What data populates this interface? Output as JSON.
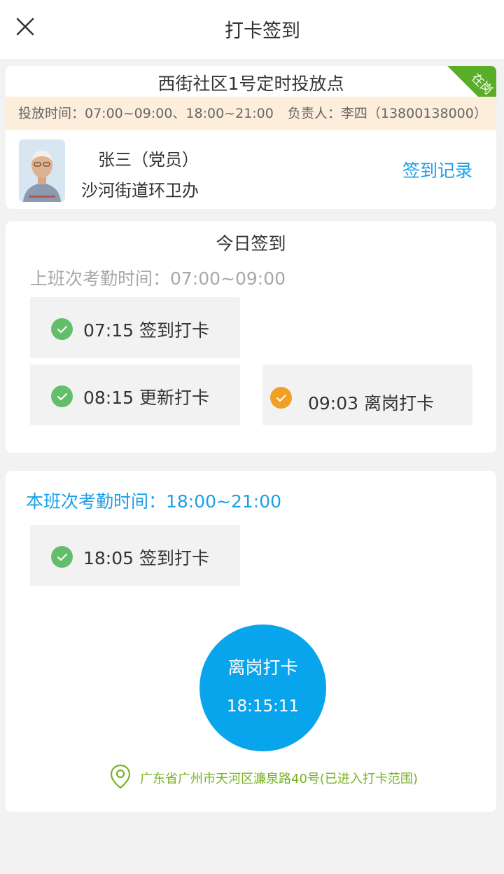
{
  "header": {
    "title": "打卡签到",
    "close_icon": "close-icon"
  },
  "station": {
    "name": "西街社区1号定时投放点",
    "status_badge": "在岗",
    "status_color": "#5aad26",
    "schedule": "投放时间：07:00~09:00、18:00~21:00",
    "manager": "负责人：李四（13800138000）"
  },
  "user": {
    "name": "张三（党员）",
    "org": "沙河街道环卫办",
    "records_link": "签到记录",
    "avatar": "avatar-photo"
  },
  "today": {
    "title": "今日签到",
    "shift1": {
      "label": "上班次考勤时间：07:00~09:00",
      "punches": [
        {
          "text": "07:15 签到打卡",
          "status": "ok",
          "icon": "check-icon",
          "color": "#63be6b"
        },
        {
          "text": "08:15 更新打卡",
          "status": "ok",
          "icon": "check-icon",
          "color": "#63be6b"
        },
        {
          "text": "09:03 离岗打卡",
          "status": "warn",
          "icon": "check-icon",
          "color": "#f0a023"
        }
      ]
    }
  },
  "current_shift": {
    "label": "本班次考勤时间：18:00~21:00",
    "punches": [
      {
        "text": "18:05 签到打卡",
        "status": "ok",
        "icon": "check-icon",
        "color": "#63be6b"
      }
    ],
    "action_button": {
      "label": "离岗打卡",
      "time": "18:15:11",
      "color": "#09a5ec"
    },
    "location": {
      "icon": "location-pin-icon",
      "text": "广东省广州市天河区濂泉路40号(已进入打卡范围)"
    }
  },
  "colors": {
    "accent": "#1aa0e8",
    "success": "#63be6b",
    "warning": "#f0a023",
    "location": "#77b223"
  }
}
